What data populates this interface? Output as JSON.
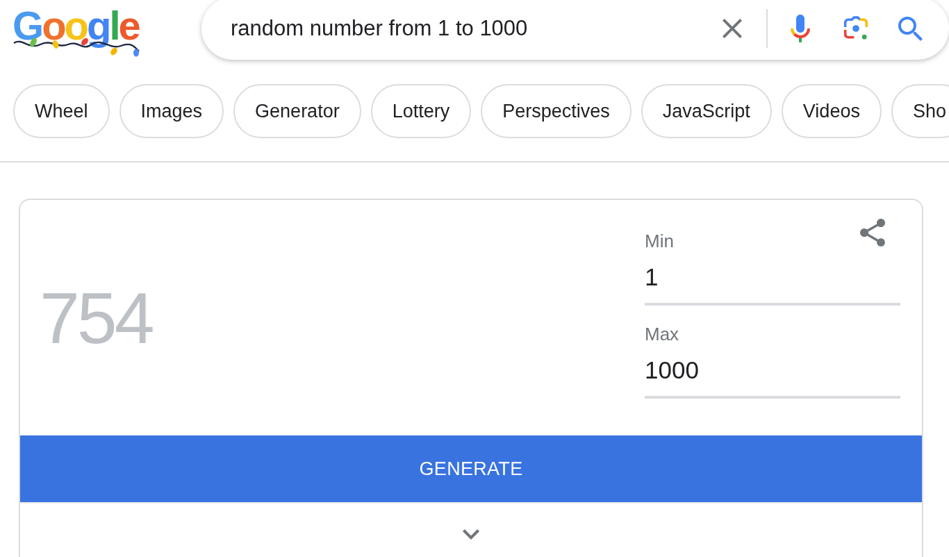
{
  "logo": {
    "text": "Google"
  },
  "search": {
    "value": "random number from 1 to 1000"
  },
  "chips": [
    "Wheel",
    "Images",
    "Generator",
    "Lottery",
    "Perspectives",
    "JavaScript",
    "Videos",
    "Sho"
  ],
  "generator": {
    "result": "754",
    "fields": [
      {
        "label": "Min",
        "value": "1"
      },
      {
        "label": "Max",
        "value": "1000"
      }
    ],
    "button": "GENERATE"
  }
}
